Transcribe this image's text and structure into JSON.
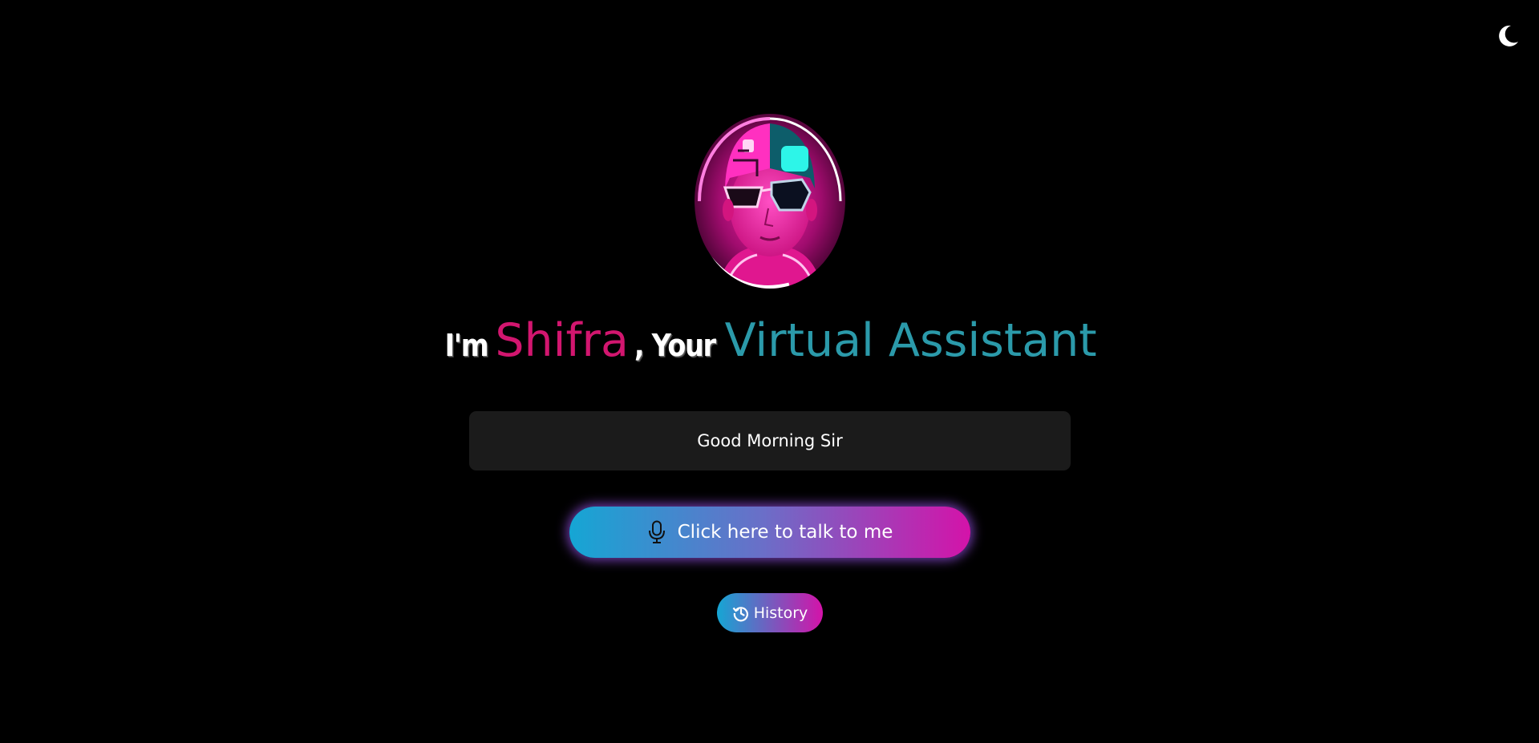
{
  "header": {
    "theme_toggle_icon": "moon-icon"
  },
  "hero": {
    "avatar_icon": "robot-avatar",
    "intro_prefix": "I'm",
    "assistant_name": "Shifra",
    "intro_middle": ", Your",
    "assistant_role": "Virtual Assistant"
  },
  "status": {
    "message": "Good Morning Sir"
  },
  "actions": {
    "talk_label": "Click here to talk to me",
    "talk_icon": "microphone-icon",
    "history_label": "History",
    "history_icon": "history-icon"
  },
  "colors": {
    "background": "#000000",
    "name_color": "#d2166f",
    "role_color": "#2b9aaa",
    "status_bg": "#1b1b1b",
    "gradient_start": "#15a6d4",
    "gradient_end": "#d413a9"
  }
}
